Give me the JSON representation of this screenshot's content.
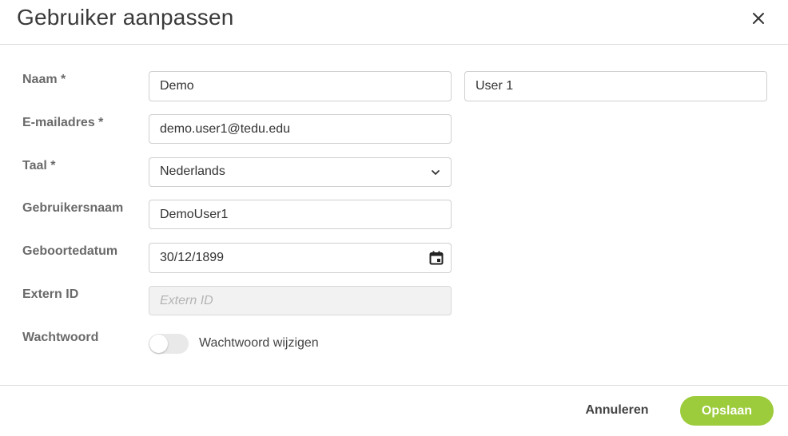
{
  "dialog": {
    "title": "Gebruiker aanpassen",
    "close_icon": "close-icon"
  },
  "form": {
    "name_label": "Naam *",
    "first_name": "Demo",
    "last_name": "User 1",
    "email_label": "E-mailadres *",
    "email": "demo.user1@tedu.edu",
    "language_label": "Taal *",
    "language": "Nederlands",
    "language_icon": "chevron-down-icon",
    "username_label": "Gebruikersnaam",
    "username": "DemoUser1",
    "birthdate_label": "Geboortedatum",
    "birthdate": "30/12/1899",
    "birthdate_icon": "calendar-icon",
    "external_id_label": "Extern ID",
    "external_id_placeholder": "Extern ID",
    "password_label": "Wachtwoord",
    "password_toggle_label": "Wachtwoord wijzigen",
    "password_toggle_on": false
  },
  "footer": {
    "cancel_label": "Annuleren",
    "save_label": "Opslaan"
  },
  "colors": {
    "accent": "#9ccb3b",
    "label": "#6a6a6a",
    "border": "#cfcfcf"
  }
}
